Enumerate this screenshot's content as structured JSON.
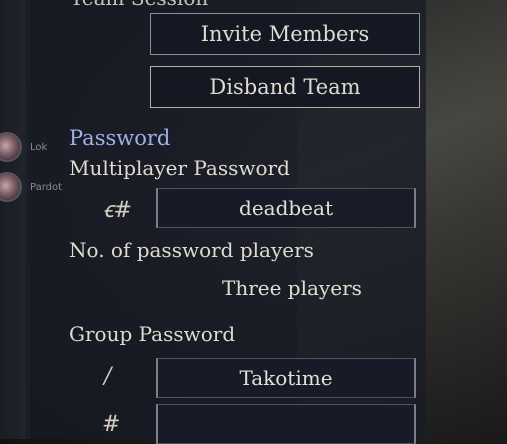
{
  "team_session": {
    "title": "Team Session",
    "invite_button": "Invite Members",
    "disband_button": "Disband Team"
  },
  "members": [
    {
      "name": "Lok"
    },
    {
      "name": "Pardot"
    }
  ],
  "password": {
    "section_title": "Password",
    "multiplayer_label": "Multiplayer Password",
    "multiplayer_value": "deadbeat",
    "players_label": "No. of password players",
    "players_value": "Three players",
    "group_label": "Group Password",
    "group_value": "Takotime",
    "group_extra_value": ""
  },
  "icons": {
    "multiplayer_icon": "password-glyph-icon",
    "group_icon": "slash-glyph-icon",
    "extra_icon": "hash-glyph-icon"
  }
}
